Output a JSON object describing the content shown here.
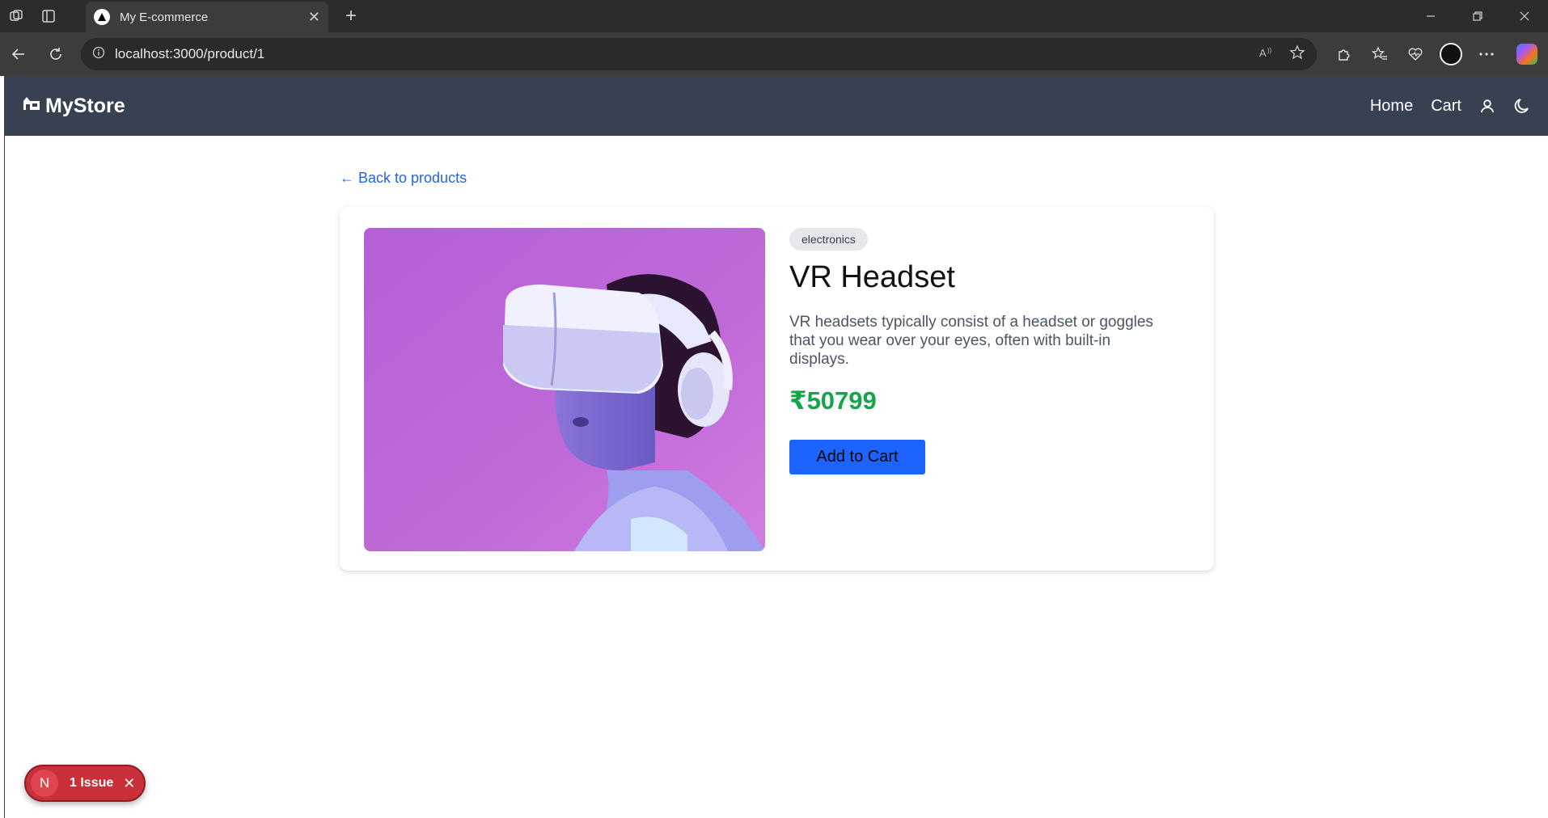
{
  "browser": {
    "tab_title": "My E-commerce",
    "url": "localhost:3000/product/1",
    "new_tab_glyph": "+",
    "tab_close_glyph": "✕"
  },
  "site": {
    "brand": "MyStore",
    "nav": {
      "home": "Home",
      "cart": "Cart"
    }
  },
  "page": {
    "back_link": "← Back to products"
  },
  "product": {
    "category": "electronics",
    "title": "VR Headset",
    "description": "VR headsets typically consist of a headset or goggles that you wear over your eyes, often with built-in displays.",
    "price": "₹50799",
    "add_to_cart": "Add to Cart",
    "image_alt": "Person wearing a white VR headset on a purple background"
  },
  "dev_overlay": {
    "badge_letter": "N",
    "label": "1 Issue",
    "close_glyph": "✕"
  },
  "colors": {
    "navbar": "#374151",
    "link": "#2563eb",
    "price": "#16a34a",
    "button": "#1d63ff",
    "issue": "#c9303a"
  }
}
